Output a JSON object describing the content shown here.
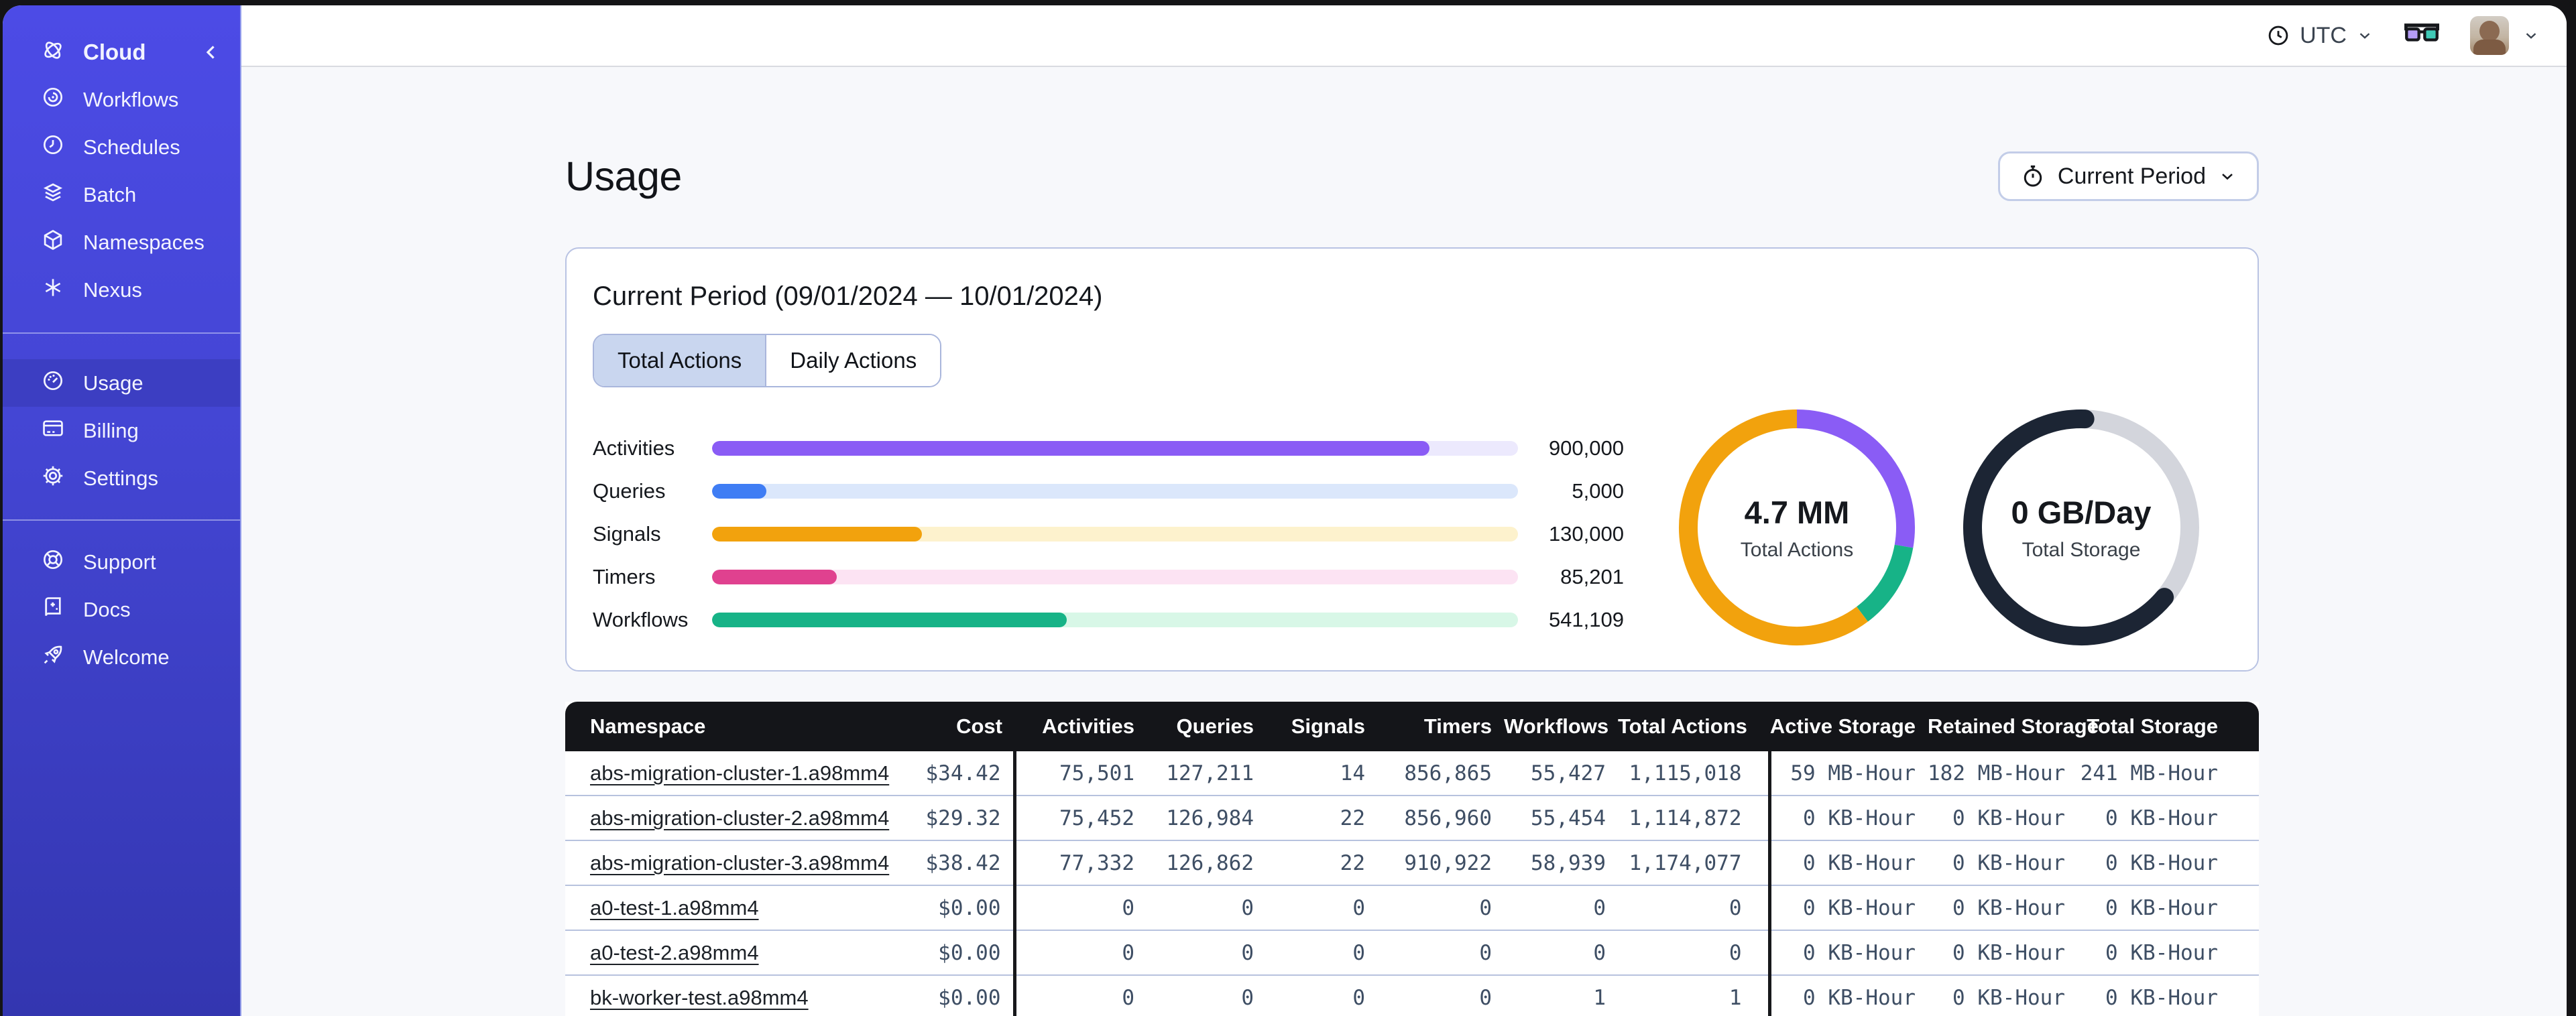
{
  "sidebar": {
    "logo": {
      "label": "Cloud",
      "icon": "temporal-logo-icon"
    },
    "collapse_icon": "chevron-left-icon",
    "colors": {
      "bg_top": "#4c4be6",
      "bg_bottom": "#3336b0",
      "active_bg": "#3c3ec2"
    },
    "nav_main": [
      {
        "label": "Workflows",
        "icon": "workflows-icon"
      },
      {
        "label": "Schedules",
        "icon": "schedules-icon"
      },
      {
        "label": "Batch",
        "icon": "batch-icon"
      },
      {
        "label": "Namespaces",
        "icon": "namespaces-icon"
      },
      {
        "label": "Nexus",
        "icon": "nexus-icon"
      }
    ],
    "nav_account": [
      {
        "label": "Usage",
        "icon": "usage-icon",
        "active": true
      },
      {
        "label": "Billing",
        "icon": "billing-icon",
        "active": false
      },
      {
        "label": "Settings",
        "icon": "settings-icon",
        "active": false
      }
    ],
    "nav_footer": [
      {
        "label": "Support",
        "icon": "support-icon"
      },
      {
        "label": "Docs",
        "icon": "docs-icon"
      },
      {
        "label": "Welcome",
        "icon": "welcome-icon"
      }
    ]
  },
  "topbar": {
    "timezone": "UTC",
    "icons": [
      "clock-icon",
      "chevron-down-icon",
      "glasses-icon",
      "avatar",
      "chevron-down-icon"
    ]
  },
  "page": {
    "title": "Usage"
  },
  "period_button": {
    "label": "Current Period",
    "icon": "stopwatch-icon"
  },
  "usage_card": {
    "title": "Current Period (09/01/2024 — 10/01/2024)",
    "tabs": [
      {
        "label": "Total Actions",
        "active": true
      },
      {
        "label": "Daily Actions",
        "active": false
      }
    ],
    "chart_data": [
      {
        "type": "bar",
        "orientation": "horizontal",
        "categories": [
          "Activities",
          "Queries",
          "Signals",
          "Timers",
          "Workflows"
        ],
        "values": [
          900000,
          5000,
          130000,
          85201,
          541109
        ],
        "value_labels": [
          "900,000",
          "5,000",
          "130,000",
          "85,201",
          "541,109"
        ],
        "fill_pct": [
          89,
          6.7,
          26,
          15.5,
          44
        ],
        "colors": [
          "#8a5cf5",
          "#3f7df4",
          "#f2a20d",
          "#e0418f",
          "#17b387"
        ],
        "track_colors": [
          "#ece9fd",
          "#dbe7fb",
          "#fdf2cd",
          "#fce3f3",
          "#d8f7e7"
        ]
      },
      {
        "type": "pie",
        "label": "4.7 MM",
        "sublabel": "Total Actions",
        "segments": [
          {
            "name": "activities",
            "color": "#8a5cf5",
            "start_deg": 0,
            "end_deg": 100
          },
          {
            "name": "workflows",
            "color": "#17b387",
            "start_deg": 100,
            "end_deg": 143
          },
          {
            "name": "signals",
            "color": "#f2a20d",
            "start_deg": 143,
            "end_deg": 360
          }
        ]
      },
      {
        "type": "pie",
        "label": "0 GB/Day",
        "sublabel": "Total Storage",
        "segments": [
          {
            "name": "available",
            "color": "#d3d5dc",
            "start_deg": 2,
            "end_deg": 130
          },
          {
            "name": "used",
            "color": "#1c2534",
            "start_deg": 130,
            "end_deg": 362,
            "linecap": "round"
          }
        ]
      }
    ]
  },
  "table": {
    "columns": [
      "Namespace",
      "Cost",
      "Activities",
      "Queries",
      "Signals",
      "Timers",
      "Workflows",
      "Total Actions",
      "Active Storage",
      "Retained Storage",
      "Total Storage"
    ],
    "rows": [
      {
        "namespace": "abs-migration-cluster-1.a98mm4",
        "cost": "$34.42",
        "activities": "75,501",
        "queries": "127,211",
        "signals": "14",
        "timers": "856,865",
        "workflows": "55,427",
        "total_actions": "1,115,018",
        "active_storage": "59 MB-Hour",
        "retained_storage": "182 MB-Hour",
        "total_storage": "241 MB-Hour"
      },
      {
        "namespace": "abs-migration-cluster-2.a98mm4",
        "cost": "$29.32",
        "activities": "75,452",
        "queries": "126,984",
        "signals": "22",
        "timers": "856,960",
        "workflows": "55,454",
        "total_actions": "1,114,872",
        "active_storage": "0 KB-Hour",
        "retained_storage": "0 KB-Hour",
        "total_storage": "0 KB-Hour"
      },
      {
        "namespace": "abs-migration-cluster-3.a98mm4",
        "cost": "$38.42",
        "activities": "77,332",
        "queries": "126,862",
        "signals": "22",
        "timers": "910,922",
        "workflows": "58,939",
        "total_actions": "1,174,077",
        "active_storage": "0 KB-Hour",
        "retained_storage": "0 KB-Hour",
        "total_storage": "0 KB-Hour"
      },
      {
        "namespace": "a0-test-1.a98mm4",
        "cost": "$0.00",
        "activities": "0",
        "queries": "0",
        "signals": "0",
        "timers": "0",
        "workflows": "0",
        "total_actions": "0",
        "active_storage": "0 KB-Hour",
        "retained_storage": "0 KB-Hour",
        "total_storage": "0 KB-Hour"
      },
      {
        "namespace": "a0-test-2.a98mm4",
        "cost": "$0.00",
        "activities": "0",
        "queries": "0",
        "signals": "0",
        "timers": "0",
        "workflows": "0",
        "total_actions": "0",
        "active_storage": "0 KB-Hour",
        "retained_storage": "0 KB-Hour",
        "total_storage": "0 KB-Hour"
      },
      {
        "namespace": "bk-worker-test.a98mm4",
        "cost": "$0.00",
        "activities": "0",
        "queries": "0",
        "signals": "0",
        "timers": "0",
        "workflows": "1",
        "total_actions": "1",
        "active_storage": "0 KB-Hour",
        "retained_storage": "0 KB-Hour",
        "total_storage": "0 KB-Hour"
      }
    ]
  }
}
